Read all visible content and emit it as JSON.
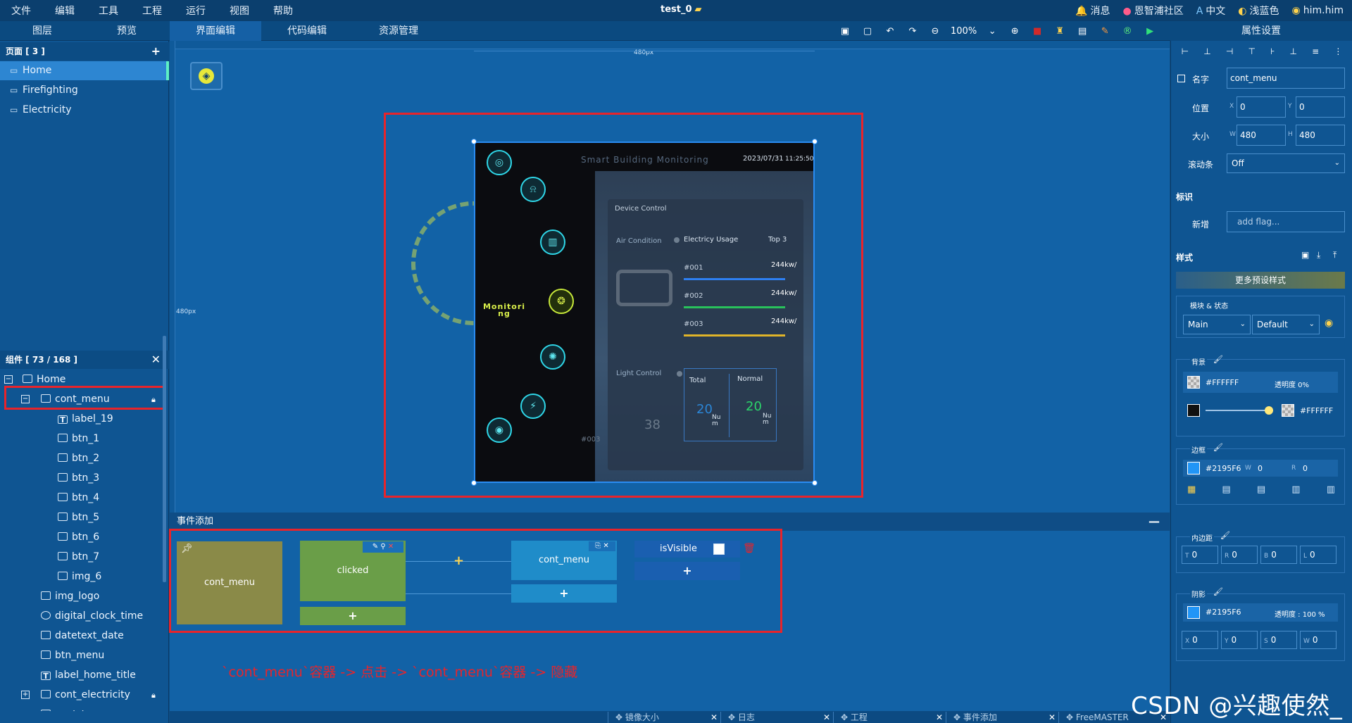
{
  "menubar": {
    "items": [
      "文件",
      "编辑",
      "工具",
      "工程",
      "运行",
      "视图",
      "帮助"
    ],
    "project_title": "test_0",
    "right_items": [
      "消息",
      "恩智浦社区",
      "中文",
      "浅蓝色",
      "him.him"
    ]
  },
  "tabs": {
    "layers": "图层",
    "preview": "预览",
    "ui_edit": "界面编辑",
    "code_edit": "代码编辑",
    "resources": "资源管理",
    "props_title": "属性设置"
  },
  "toolbar": {
    "zoom": "100%"
  },
  "pages": {
    "header": "页面 [ 3 ]",
    "add": "+",
    "items": [
      "Home",
      "Firefighting",
      "Electricity"
    ]
  },
  "components": {
    "header": "组件 [ 73 / 168 ]",
    "items": [
      "Home",
      "cont_menu",
      "label_19",
      "btn_1",
      "btn_2",
      "btn_3",
      "btn_4",
      "btn_5",
      "btn_6",
      "btn_7",
      "img_6",
      "img_logo",
      "digital_clock_time",
      "datetext_date",
      "btn_menu",
      "label_home_title",
      "cont_electricity",
      "cont_temp"
    ]
  },
  "canvas": {
    "width_label": "480px",
    "height_label": "480px",
    "preview": {
      "title": "Smart Building Monitoring",
      "date": "2023/07/31",
      "time": "11:25:50",
      "monitor_label": "Monitori ng",
      "device_control": "Device Control",
      "air_condition": "Air Condition",
      "electricity_usage": "Electricy Usage",
      "top3": "Top 3",
      "usage": [
        {
          "id": "#001",
          "value": "244kw/",
          "color": "#2e7ff2"
        },
        {
          "id": "#002",
          "value": "244kw/",
          "color": "#28c25b"
        },
        {
          "id": "#003",
          "value": "244kw/",
          "color": "#e0b429"
        }
      ],
      "light_control": "Light Control",
      "total": "Total",
      "normal": "Normal",
      "total_value": "20",
      "normal_value": "20",
      "num_unit": "Nu m",
      "temp_value": "38",
      "room": "#003"
    }
  },
  "events": {
    "header": "事件添加",
    "minimize": "—",
    "source": "cont_menu",
    "trigger": "clicked",
    "target": "cont_menu",
    "property": "isVisible",
    "plus": "+",
    "note": "`cont_menu`容器 -> 点击 -> `cont_menu`容器 -> 隐藏"
  },
  "bottom_tabs": [
    "镜像大小",
    "日志",
    "工程",
    "事件添加",
    "FreeMASTER"
  ],
  "props": {
    "name_label": "名字",
    "name_value": "cont_menu",
    "pos_label": "位置",
    "x": "0",
    "y": "0",
    "size_label": "大小",
    "w": "480",
    "h": "480",
    "scroll_label": "滚动条",
    "scroll_value": "Off",
    "flag_section": "标识",
    "flag_add_label": "新增",
    "flag_placeholder": "add flag...",
    "style_section": "样式",
    "preset_btn": "更多预设样式",
    "part_state_label": "模块 & 状态",
    "part": "Main",
    "state": "Default",
    "bg_label": "背景",
    "bg_color": "#FFFFFF",
    "bg_opacity": "透明度 0%",
    "grad_color": "#FFFFFF",
    "border_label": "边框",
    "border_color": "#2195F6",
    "border_w": "0",
    "border_r": "0",
    "padding_label": "内边距",
    "pad_t": "0",
    "pad_r": "0",
    "pad_b": "0",
    "pad_l": "0",
    "shadow_label": "阴影",
    "shadow_color": "#2195F6",
    "shadow_opacity": "透明度 : 100 %",
    "shadow_x": "0",
    "shadow_y": "0",
    "shadow_s": "0",
    "shadow_w": "0"
  },
  "watermark": "CSDN @兴趣使然_"
}
